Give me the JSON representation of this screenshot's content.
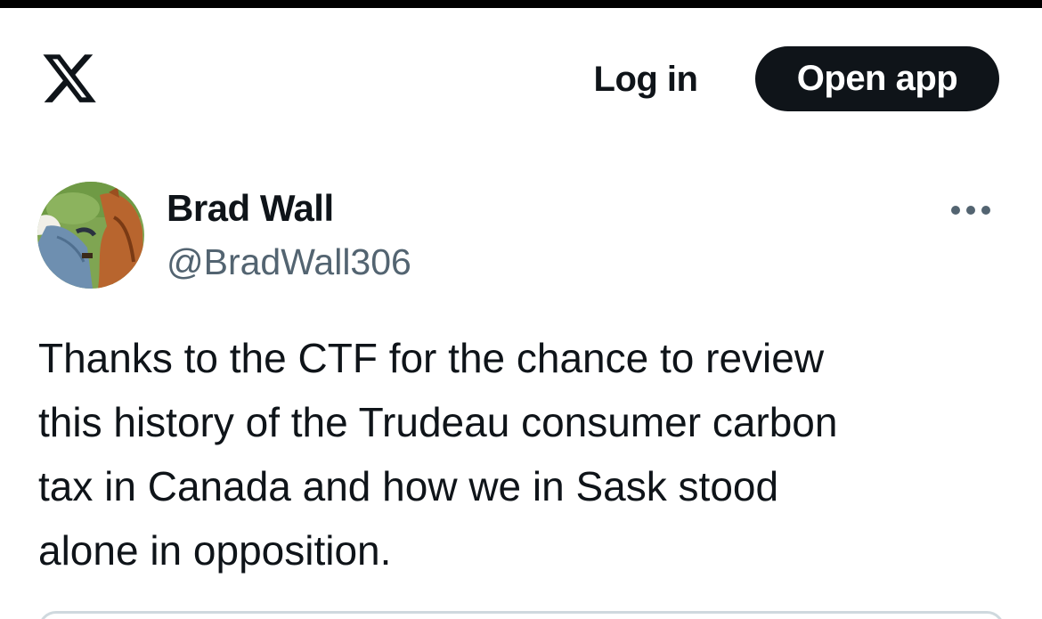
{
  "header": {
    "logo_icon": "x-logo-icon",
    "login_label": "Log in",
    "open_app_label": "Open app"
  },
  "tweet": {
    "author": {
      "name": "Brad Wall",
      "handle": "@BradWall306",
      "avatar_icon": "avatar-photo-horse"
    },
    "more_icon": "more-dots-icon",
    "text": "Thanks to the CTF for the chance to review\nthis history of the Trudeau consumer carbon\ntax in Canada and how we in Sask stood\nalone in opposition."
  },
  "colors": {
    "text_primary": "#0f1419",
    "text_secondary": "#536471",
    "button_dark": "#0f1419",
    "border": "#cfd9de",
    "background": "#ffffff"
  }
}
